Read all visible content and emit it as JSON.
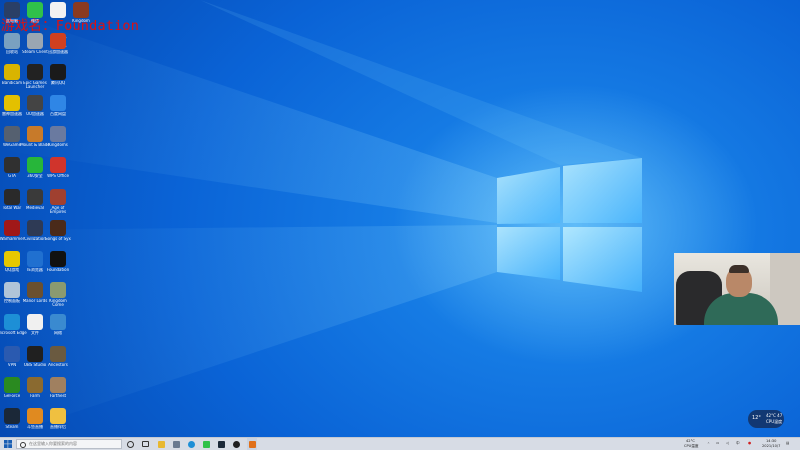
{
  "overlay": {
    "line1": "游戏名：Foundation",
    "line2": "VI"
  },
  "desktop_icons": [
    {
      "label": "此电脑",
      "color": "#2a3f66"
    },
    {
      "label": "微信",
      "color": "#30c14a"
    },
    {
      "label": "",
      "color": "#f2f2f2"
    },
    {
      "label": "Kingdom",
      "color": "#8a3a20"
    },
    {
      "label": "回收站",
      "color": "#7aa0c0"
    },
    {
      "label": "Steam Client",
      "color": "#9aa6b2"
    },
    {
      "label": "迅游加速器",
      "color": "#d04020"
    },
    {
      "label": "Bandicam",
      "color": "#d9b400"
    },
    {
      "label": "Epic Games Launcher",
      "color": "#222222"
    },
    {
      "label": "腾讯QQ",
      "color": "#1a1a1a"
    },
    {
      "label": "雷神加速器",
      "color": "#e3c000"
    },
    {
      "label": "UU加速器",
      "color": "#444444"
    },
    {
      "label": "百度网盘",
      "color": "#2f86e6"
    },
    {
      "label": "WeGame",
      "color": "#556070"
    },
    {
      "label": "Mount & Blade",
      "color": "#c77a2a"
    },
    {
      "label": "Kingdoms",
      "color": "#6a7aa0"
    },
    {
      "label": "GTA",
      "color": "#303030"
    },
    {
      "label": "360安全",
      "color": "#27b63a"
    },
    {
      "label": "WPS Office",
      "color": "#d0342c"
    },
    {
      "label": "Total War",
      "color": "#2a2a2a"
    },
    {
      "label": "Medieval",
      "color": "#3a3a3a"
    },
    {
      "label": "Age of Empires",
      "color": "#a04030"
    },
    {
      "label": "Warhammer",
      "color": "#a01818"
    },
    {
      "label": "Civilization",
      "color": "#2e3a55"
    },
    {
      "label": "Songs of Syx",
      "color": "#4a2a1a"
    },
    {
      "label": "QQ游戏",
      "color": "#e6c800"
    },
    {
      "label": "IE浏览器",
      "color": "#2070d0"
    },
    {
      "label": "Foundation",
      "color": "#111111"
    },
    {
      "label": "控制面板",
      "color": "#b0c4d8"
    },
    {
      "label": "Manor Lords",
      "color": "#6a5030"
    },
    {
      "label": "Kingdom Come",
      "color": "#8a9a70"
    },
    {
      "label": "Microsoft Edge",
      "color": "#1d8fd6"
    },
    {
      "label": "文件",
      "color": "#f0f0f0"
    },
    {
      "label": "网络",
      "color": "#3a8ad0"
    },
    {
      "label": "VPN",
      "color": "#2a5ab0"
    },
    {
      "label": "OBS Studio",
      "color": "#202020"
    },
    {
      "label": "Ancestors",
      "color": "#6a5a40"
    },
    {
      "label": "GeForce",
      "color": "#2a8a20"
    },
    {
      "label": "Farm",
      "color": "#8a6a30"
    },
    {
      "label": "Farthest",
      "color": "#a08060"
    },
    {
      "label": "Steam",
      "color": "#1b2838"
    },
    {
      "label": "斗鱼直播",
      "color": "#e08a20"
    },
    {
      "label": "直播伴侣",
      "color": "#f0c040"
    }
  ],
  "webcam": {
    "label": "webcam"
  },
  "weather": {
    "temp": "12°",
    "line1": "42°C 47",
    "line2": "CPU温度"
  },
  "taskbar": {
    "search_placeholder": "在这里输入你要搜索的内容",
    "tray_text1": "42°C",
    "tray_text2": "CPU温度",
    "time": "14:30",
    "date": "2021/10/7"
  },
  "colors": {
    "taskbar": "#d7dce5",
    "overlay_red": "#e01010",
    "desktop_blue": "#0a63d6"
  }
}
